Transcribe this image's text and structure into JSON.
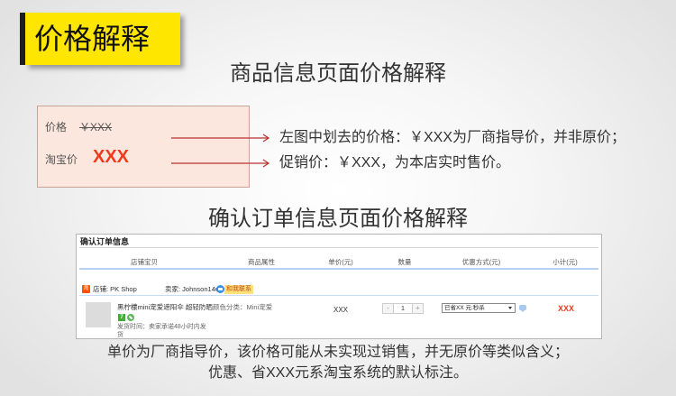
{
  "banner": {
    "title": "价格解释"
  },
  "product_section": {
    "heading": "商品信息页面价格解释",
    "sample": {
      "price_label": "价格",
      "original_price": "￥XXX",
      "taobao_price_label": "淘宝价",
      "taobao_price": "XXX"
    },
    "notes": [
      "左图中划去的价格：￥XXX为厂商指导价，并非原价；",
      "促销价：￥XXX，为本店实时售价。"
    ]
  },
  "order_section": {
    "heading": "确认订单信息页面价格解释",
    "panel": {
      "title": "确认订单信息",
      "columns": [
        "店铺宝贝",
        "商品属性",
        "单价(元)",
        "数量",
        "优惠方式(元)",
        "小计(元)"
      ],
      "store": {
        "icon_text": "淘",
        "shop": "店铺: PK Shop",
        "seller": "卖家: Johnson14u",
        "contact_label": "和我联系"
      },
      "item": {
        "title": "黑柠檬mini宠爱遮阳伞 超轻防晒",
        "attribute": "颜色分类：Mini宠爱",
        "badge_7": "7",
        "shipping_line1": "发货时间：卖家承诺48小时内发",
        "shipping_line2": "货",
        "unit_price": "XXX",
        "quantity_minus": "-",
        "quantity": "1",
        "quantity_plus": "+",
        "discount_option": "已省XX 元:秒杀",
        "subtotal": "XXX"
      }
    },
    "notes": [
      "单价为厂商指导价，该价格可能从未实现过销售，并无原价等类似含义；",
      "优惠、省XXX元系淘宝系统的默认标注。"
    ]
  },
  "icons": {
    "pointer_arrows": "arrow-right-icon",
    "store": "taobao-store-icon",
    "contact": "chat-icon",
    "thumbnail": "product-thumbnail",
    "leaf_badge": "leaf-icon",
    "dropdown": "chevron-down-icon",
    "message": "message-bubble-icon"
  },
  "colors": {
    "banner_yellow": "#ffe600",
    "banner_bar": "#1e1e1e",
    "price_red": "#f2391c",
    "arrow_red": "#b8312f",
    "sample_box_bg": "#fce7de",
    "header_underline": "#b6d1f5",
    "badge_green": "#3cb034"
  }
}
